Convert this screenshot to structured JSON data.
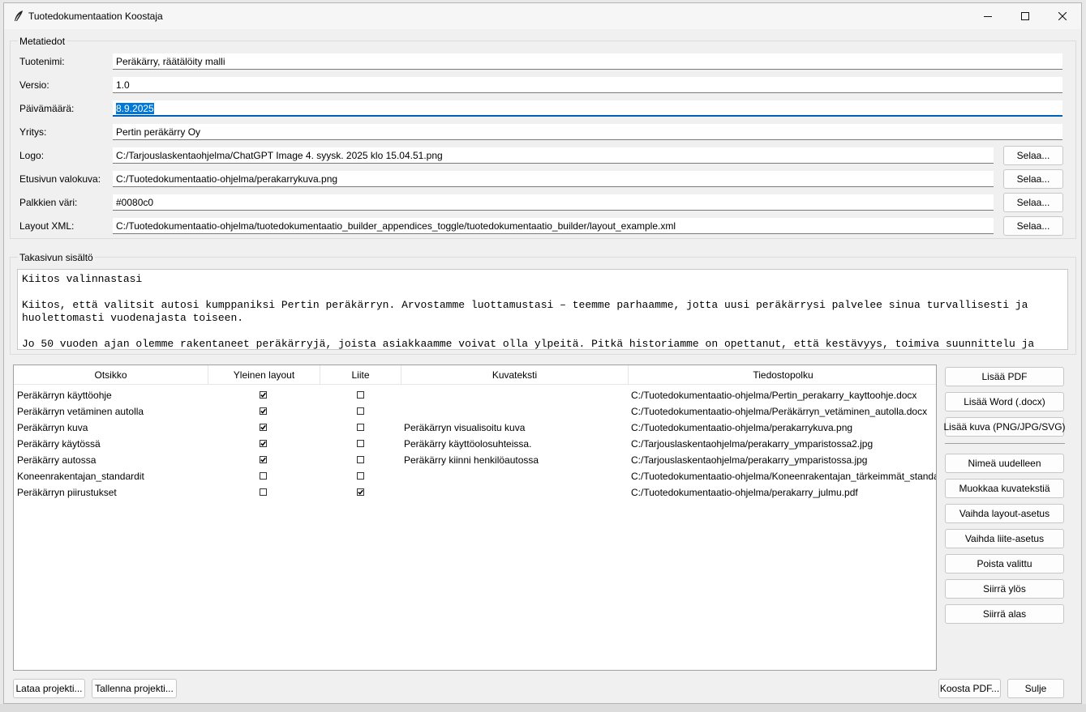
{
  "window": {
    "title": "Tuotedokumentaation Koostaja",
    "icons": {
      "app": "feather-icon",
      "minimize": "minimize-icon",
      "maximize": "maximize-icon",
      "close": "close-icon"
    }
  },
  "metadata": {
    "group_label": "Metatiedot",
    "fields": [
      {
        "label": "Tuotenimi:",
        "value": "Peräkärry, räätälöity malli"
      },
      {
        "label": "Versio:",
        "value": "1.0"
      },
      {
        "label": "Päivämäärä:",
        "value": "8.9.2025"
      },
      {
        "label": "Yritys:",
        "value": "Pertin peräkärry Oy"
      },
      {
        "label": "Logo:",
        "value": "C:/Tarjouslaskentaohjelma/ChatGPT Image 4. syysk. 2025 klo 15.04.51.png",
        "button": "Selaa..."
      },
      {
        "label": "Etusivun valokuva:",
        "value": "C:/Tuotedokumentaatio-ohjelma/perakarrykuva.png",
        "button": "Selaa..."
      },
      {
        "label": "Palkkien väri:",
        "value": "#0080c0",
        "button": "Selaa..."
      },
      {
        "label": "Layout XML:",
        "value": "C:/Tuotedokumentaatio-ohjelma/tuotedokumentaatio_builder_appendices_toggle/tuotedokumentaatio_builder/layout_example.xml",
        "button": "Selaa..."
      }
    ]
  },
  "backpage": {
    "group_label": "Takasivun sisältö",
    "text": "Kiitos valinnastasi\n\nKiitos, että valitsit autosi kumppaniksi Pertin peräkärryn. Arvostamme luottamustasi – teemme parhaamme, jotta uusi peräkärrysi palvelee sinua turvallisesti ja huolettomasti vuodenajasta toiseen.\n\nJo 50 vuoden ajan olemme rakentaneet peräkärryjä, joista asiakkaamme voivat olla ylpeitä. Pitkä historiamme on opettanut, että kestävyys, toimiva suunnittelu ja"
  },
  "table": {
    "columns": [
      "Otsikko",
      "Yleinen layout",
      "Liite",
      "Kuvateksti",
      "Tiedostopolku"
    ],
    "rows": [
      {
        "title": "Peräkärryn käyttöohje",
        "layout": true,
        "appendix": false,
        "caption": "",
        "path": "C:/Tuotedokumentaatio-ohjelma/Pertin_perakarry_kayttoohje.docx"
      },
      {
        "title": "Peräkärryn vetäminen autolla",
        "layout": true,
        "appendix": false,
        "caption": "",
        "path": "C:/Tuotedokumentaatio-ohjelma/Peräkärryn_vetäminen_autolla.docx"
      },
      {
        "title": "Peräkärryn kuva",
        "layout": true,
        "appendix": false,
        "caption": "Peräkärryn visualisoitu kuva",
        "path": "C:/Tuotedokumentaatio-ohjelma/perakarrykuva.png"
      },
      {
        "title": "Peräkärry käytössä",
        "layout": true,
        "appendix": false,
        "caption": "Peräkärry käyttöolosuhteissa.",
        "path": "C:/Tarjouslaskentaohjelma/perakarry_ymparistossa2.jpg"
      },
      {
        "title": "Peräkärry autossa",
        "layout": true,
        "appendix": false,
        "caption": "Peräkärry kiinni henkilöautossa",
        "path": "C:/Tarjouslaskentaohjelma/perakarry_ymparistossa.jpg"
      },
      {
        "title": "Koneenrakentajan_standardit",
        "layout": false,
        "appendix": false,
        "caption": "",
        "path": "C:/Tuotedokumentaatio-ohjelma/Koneenrakentajan_tärkeimmät_standa"
      },
      {
        "title": "Peräkärryn piirustukset",
        "layout": false,
        "appendix": true,
        "caption": "",
        "path": "C:/Tuotedokumentaatio-ohjelma/perakarry_julmu.pdf"
      }
    ]
  },
  "side_buttons": {
    "add_pdf": "Lisää PDF",
    "add_word": "Lisää Word (.docx)",
    "add_image": "Lisää kuva (PNG/JPG/SVG)",
    "rename": "Nimeä uudelleen",
    "edit_caption": "Muokkaa kuvatekstiä",
    "toggle_layout": "Vaihda layout-asetus",
    "toggle_appendix": "Vaihda liite-asetus",
    "remove": "Poista valittu",
    "move_up": "Siirrä ylös",
    "move_down": "Siirrä alas"
  },
  "bottom": {
    "load": "Lataa projekti...",
    "save": "Tallenna projekti...",
    "build": "Koosta PDF...",
    "close": "Sulje"
  }
}
